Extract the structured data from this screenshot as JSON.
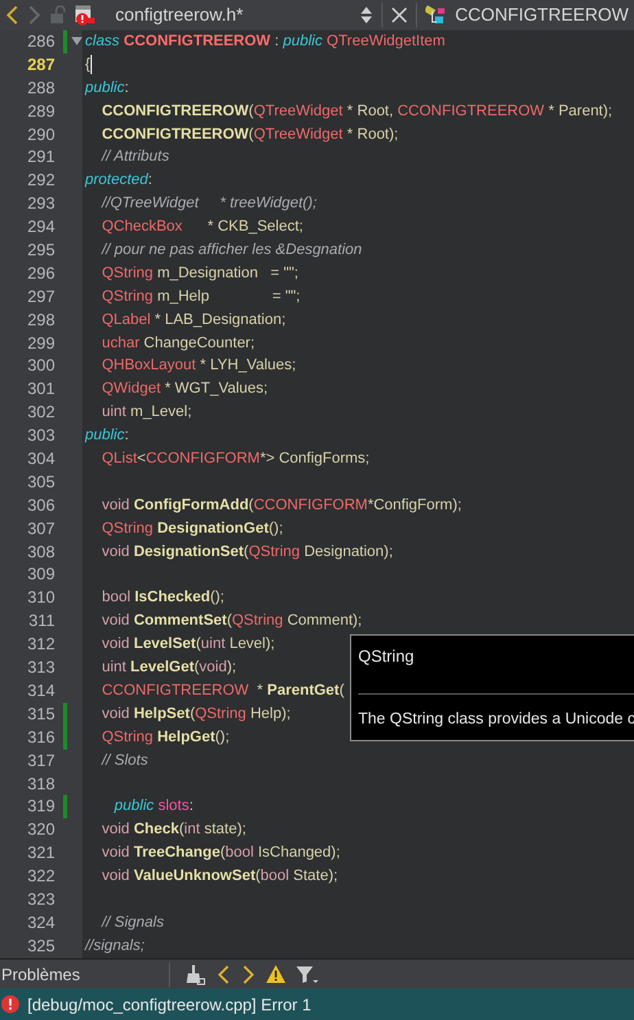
{
  "tab_bar": {
    "file_name": "configtreerow.h*",
    "symbol": "CCONFIGTREEROW"
  },
  "lines": [
    {
      "number": "286",
      "changed": true,
      "current": false,
      "foldable": true,
      "tokens": [
        {
          "kind": "kw",
          "text": "class "
        },
        {
          "kind": "cls",
          "text": "CCONFIGTREEROW"
        },
        {
          "kind": "id",
          "text": " : "
        },
        {
          "kind": "kw",
          "text": "public "
        },
        {
          "kind": "type",
          "text": "QTreeWidgetItem"
        }
      ]
    },
    {
      "number": "287",
      "changed": false,
      "current": true,
      "foldable": false,
      "tokens": [
        {
          "kind": "id",
          "text": "{"
        }
      ]
    },
    {
      "number": "288",
      "changed": false,
      "current": false,
      "foldable": false,
      "tokens": [
        {
          "kind": "kw",
          "text": "public"
        },
        {
          "kind": "id",
          "text": ":"
        }
      ]
    },
    {
      "number": "289",
      "changed": false,
      "current": false,
      "foldable": false,
      "tokens": [
        {
          "kind": "fn",
          "text": "    CCONFIGTREEROW"
        },
        {
          "kind": "id",
          "text": "("
        },
        {
          "kind": "type",
          "text": "QTreeWidget"
        },
        {
          "kind": "id",
          "text": " * Root, "
        },
        {
          "kind": "type",
          "text": "CCONFIGTREEROW"
        },
        {
          "kind": "id",
          "text": " * Parent);"
        }
      ]
    },
    {
      "number": "290",
      "changed": false,
      "current": false,
      "foldable": false,
      "tokens": [
        {
          "kind": "fn",
          "text": "    CCONFIGTREEROW"
        },
        {
          "kind": "id",
          "text": "("
        },
        {
          "kind": "type",
          "text": "QTreeWidget"
        },
        {
          "kind": "id",
          "text": " * Root);"
        }
      ]
    },
    {
      "number": "291",
      "changed": false,
      "current": false,
      "foldable": false,
      "tokens": [
        {
          "kind": "cm",
          "text": "    // Attributs"
        }
      ]
    },
    {
      "number": "292",
      "changed": false,
      "current": false,
      "foldable": false,
      "tokens": [
        {
          "kind": "kw",
          "text": "protected"
        },
        {
          "kind": "id",
          "text": ":"
        }
      ]
    },
    {
      "number": "293",
      "changed": false,
      "current": false,
      "foldable": false,
      "tokens": [
        {
          "kind": "cm",
          "text": "    //QTreeWidget     * treeWidget();"
        }
      ]
    },
    {
      "number": "294",
      "changed": false,
      "current": false,
      "foldable": false,
      "tokens": [
        {
          "kind": "type",
          "text": "    QCheckBox"
        },
        {
          "kind": "id",
          "text": "      * CKB_Select;"
        }
      ]
    },
    {
      "number": "295",
      "changed": false,
      "current": false,
      "foldable": false,
      "tokens": [
        {
          "kind": "cm",
          "text": "    // pour ne pas afficher les &Desgnation"
        }
      ]
    },
    {
      "number": "296",
      "changed": false,
      "current": false,
      "foldable": false,
      "tokens": [
        {
          "kind": "type",
          "text": "    QString"
        },
        {
          "kind": "id",
          "text": " m_Designation   = \"\";"
        }
      ]
    },
    {
      "number": "297",
      "changed": false,
      "current": false,
      "foldable": false,
      "tokens": [
        {
          "kind": "type",
          "text": "    QString"
        },
        {
          "kind": "id",
          "text": " m_Help               = \"\";"
        }
      ]
    },
    {
      "number": "298",
      "changed": false,
      "current": false,
      "foldable": false,
      "tokens": [
        {
          "kind": "type",
          "text": "    QLabel"
        },
        {
          "kind": "id",
          "text": " * LAB_Designation;"
        }
      ]
    },
    {
      "number": "299",
      "changed": false,
      "current": false,
      "foldable": false,
      "tokens": [
        {
          "kind": "type",
          "text": "    uchar"
        },
        {
          "kind": "id",
          "text": " ChangeCounter;"
        }
      ]
    },
    {
      "number": "300",
      "changed": false,
      "current": false,
      "foldable": false,
      "tokens": [
        {
          "kind": "type",
          "text": "    QHBoxLayout"
        },
        {
          "kind": "id",
          "text": " * LYH_Values;"
        }
      ]
    },
    {
      "number": "301",
      "changed": false,
      "current": false,
      "foldable": false,
      "tokens": [
        {
          "kind": "type",
          "text": "    QWidget"
        },
        {
          "kind": "id",
          "text": " * WGT_Values;"
        }
      ]
    },
    {
      "number": "302",
      "changed": false,
      "current": false,
      "foldable": false,
      "tokens": [
        {
          "kind": "prim",
          "text": "    uint"
        },
        {
          "kind": "id",
          "text": " m_Level;"
        }
      ]
    },
    {
      "number": "303",
      "changed": false,
      "current": false,
      "foldable": false,
      "tokens": [
        {
          "kind": "kw",
          "text": "public"
        },
        {
          "kind": "id",
          "text": ":"
        }
      ]
    },
    {
      "number": "304",
      "changed": false,
      "current": false,
      "foldable": false,
      "tokens": [
        {
          "kind": "type",
          "text": "    QList"
        },
        {
          "kind": "id",
          "text": "<"
        },
        {
          "kind": "type",
          "text": "CCONFIGFORM"
        },
        {
          "kind": "id",
          "text": "*> ConfigForms;"
        }
      ]
    },
    {
      "number": "305",
      "changed": false,
      "current": false,
      "foldable": false
    },
    {
      "number": "306",
      "changed": false,
      "current": false,
      "foldable": false,
      "tokens": [
        {
          "kind": "prim",
          "text": "    void "
        },
        {
          "kind": "fn",
          "text": "ConfigFormAdd"
        },
        {
          "kind": "id",
          "text": "("
        },
        {
          "kind": "type",
          "text": "CCONFIGFORM"
        },
        {
          "kind": "id",
          "text": "*ConfigForm);"
        }
      ]
    },
    {
      "number": "307",
      "changed": false,
      "current": false,
      "foldable": false,
      "tokens": [
        {
          "kind": "type",
          "text": "    QString "
        },
        {
          "kind": "fn",
          "text": "DesignationGet"
        },
        {
          "kind": "id",
          "text": "();"
        }
      ]
    },
    {
      "number": "308",
      "changed": false,
      "current": false,
      "foldable": false,
      "tokens": [
        {
          "kind": "prim",
          "text": "    void "
        },
        {
          "kind": "fn",
          "text": "DesignationSet"
        },
        {
          "kind": "id",
          "text": "("
        },
        {
          "kind": "type",
          "text": "QString"
        },
        {
          "kind": "id",
          "text": " Designation);"
        }
      ]
    },
    {
      "number": "309",
      "changed": false,
      "current": false,
      "foldable": false
    },
    {
      "number": "310",
      "changed": false,
      "current": false,
      "foldable": false,
      "tokens": [
        {
          "kind": "prim",
          "text": "    bool "
        },
        {
          "kind": "fn",
          "text": "IsChecked"
        },
        {
          "kind": "id",
          "text": "();"
        }
      ]
    },
    {
      "number": "311",
      "changed": false,
      "current": false,
      "foldable": false,
      "tokens": [
        {
          "kind": "prim",
          "text": "    void "
        },
        {
          "kind": "fn",
          "text": "CommentSet"
        },
        {
          "kind": "id",
          "text": "("
        },
        {
          "kind": "type",
          "text": "QString"
        },
        {
          "kind": "id",
          "text": " Comment);"
        }
      ]
    },
    {
      "number": "312",
      "changed": false,
      "current": false,
      "foldable": false,
      "tokens": [
        {
          "kind": "prim",
          "text": "    void "
        },
        {
          "kind": "fn",
          "text": "LevelSet"
        },
        {
          "kind": "id",
          "text": "("
        },
        {
          "kind": "prim",
          "text": "uint"
        },
        {
          "kind": "id",
          "text": " Level);"
        }
      ]
    },
    {
      "number": "313",
      "changed": false,
      "current": false,
      "foldable": false,
      "tokens": [
        {
          "kind": "prim",
          "text": "    uint "
        },
        {
          "kind": "fn",
          "text": "LevelGet"
        },
        {
          "kind": "id",
          "text": "("
        },
        {
          "kind": "prim",
          "text": "void"
        },
        {
          "kind": "id",
          "text": ");"
        }
      ]
    },
    {
      "number": "314",
      "changed": false,
      "current": false,
      "foldable": false,
      "tokens": [
        {
          "kind": "type",
          "text": "    CCONFIGTREEROW"
        },
        {
          "kind": "id",
          "text": "  * "
        },
        {
          "kind": "fn",
          "text": "ParentGet"
        },
        {
          "kind": "id",
          "text": "("
        }
      ]
    },
    {
      "number": "315",
      "changed": true,
      "current": false,
      "foldable": false,
      "tokens": [
        {
          "kind": "prim",
          "text": "    void "
        },
        {
          "kind": "fn",
          "text": "HelpSet"
        },
        {
          "kind": "id",
          "text": "("
        },
        {
          "kind": "type",
          "text": "QString"
        },
        {
          "kind": "id",
          "text": " Help);"
        }
      ]
    },
    {
      "number": "316",
      "changed": true,
      "current": false,
      "foldable": false,
      "tokens": [
        {
          "kind": "type",
          "text": "    QString "
        },
        {
          "kind": "fn",
          "text": "HelpGet"
        },
        {
          "kind": "id",
          "text": "();"
        }
      ]
    },
    {
      "number": "317",
      "changed": false,
      "current": false,
      "foldable": false,
      "tokens": [
        {
          "kind": "cm",
          "text": "    // Slots"
        }
      ]
    },
    {
      "number": "318",
      "changed": false,
      "current": false,
      "foldable": false
    },
    {
      "number": "319",
      "changed": true,
      "current": false,
      "foldable": false,
      "tokens": [
        {
          "kind": "kw",
          "text": "       public "
        },
        {
          "kind": "slot",
          "text": "slots"
        },
        {
          "kind": "id",
          "text": ":"
        }
      ]
    },
    {
      "number": "320",
      "changed": false,
      "current": false,
      "foldable": false,
      "tokens": [
        {
          "kind": "prim",
          "text": "    void "
        },
        {
          "kind": "fn",
          "text": "Check"
        },
        {
          "kind": "id",
          "text": "("
        },
        {
          "kind": "prim",
          "text": "int"
        },
        {
          "kind": "id",
          "text": " state);"
        }
      ]
    },
    {
      "number": "321",
      "changed": false,
      "current": false,
      "foldable": false,
      "tokens": [
        {
          "kind": "prim",
          "text": "    void "
        },
        {
          "kind": "fn",
          "text": "TreeChange"
        },
        {
          "kind": "id",
          "text": "("
        },
        {
          "kind": "prim",
          "text": "bool"
        },
        {
          "kind": "id",
          "text": " IsChanged);"
        }
      ]
    },
    {
      "number": "322",
      "changed": false,
      "current": false,
      "foldable": false,
      "tokens": [
        {
          "kind": "prim",
          "text": "    void "
        },
        {
          "kind": "fn",
          "text": "ValueUnknowSet"
        },
        {
          "kind": "id",
          "text": "("
        },
        {
          "kind": "prim",
          "text": "bool"
        },
        {
          "kind": "id",
          "text": " State);"
        }
      ]
    },
    {
      "number": "323",
      "changed": false,
      "current": false,
      "foldable": false
    },
    {
      "number": "324",
      "changed": false,
      "current": false,
      "foldable": false,
      "tokens": [
        {
          "kind": "cm",
          "text": "    // Signals"
        }
      ]
    },
    {
      "number": "325",
      "changed": false,
      "current": false,
      "foldable": false,
      "tokens": [
        {
          "kind": "cm",
          "text": "//signals;"
        }
      ]
    }
  ],
  "tooltip": {
    "title": "QString",
    "text": "The QString class provides a Unicode c"
  },
  "panel": {
    "title": "Problèmes",
    "issues": [
      {
        "kind": "error",
        "text": "[debug/moc_configtreerow.cpp] Error 1"
      }
    ]
  }
}
